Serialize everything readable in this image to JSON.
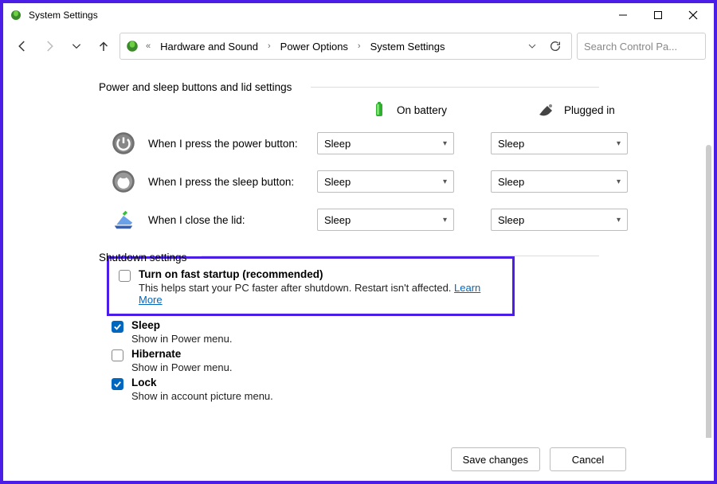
{
  "window": {
    "title": "System Settings"
  },
  "breadcrumb": {
    "ellipsis": "«",
    "items": [
      "Hardware and Sound",
      "Power Options",
      "System Settings"
    ]
  },
  "search": {
    "placeholder": "Search Control Pa..."
  },
  "section1": {
    "heading": "Power and sleep buttons and lid settings"
  },
  "columns": {
    "battery": "On battery",
    "plugged": "Plugged in"
  },
  "rows": {
    "power": {
      "label": "When I press the power button:",
      "battery": "Sleep",
      "plugged": "Sleep"
    },
    "sleep": {
      "label": "When I press the sleep button:",
      "battery": "Sleep",
      "plugged": "Sleep"
    },
    "lid": {
      "label": "When I close the lid:",
      "battery": "Sleep",
      "plugged": "Sleep"
    }
  },
  "section2": {
    "heading": "Shutdown settings"
  },
  "shutdown": {
    "fast": {
      "title": "Turn on fast startup (recommended)",
      "sub": "This helps start your PC faster after shutdown. Restart isn't affected. ",
      "link": "Learn More",
      "checked": false
    },
    "sleep": {
      "title": "Sleep",
      "sub": "Show in Power menu.",
      "checked": true
    },
    "hibernate": {
      "title": "Hibernate",
      "sub": "Show in Power menu.",
      "checked": false
    },
    "lock": {
      "title": "Lock",
      "sub": "Show in account picture menu.",
      "checked": true
    }
  },
  "footer": {
    "save": "Save changes",
    "cancel": "Cancel"
  }
}
